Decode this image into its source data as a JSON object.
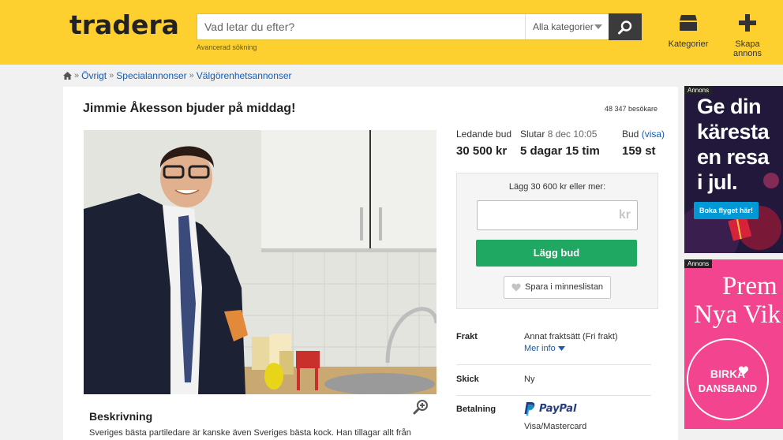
{
  "header": {
    "logo": "tradera",
    "search_placeholder": "Vad letar du efter?",
    "category_select": "Alla kategorier",
    "advanced_search": "Avancerad sökning",
    "categories_label": "Kategorier",
    "create_listing_label": "Skapa annons"
  },
  "breadcrumb": {
    "items": [
      "Övrigt",
      "Specialannonser",
      "Välgörenhetsannonser"
    ],
    "separator": "»"
  },
  "listing": {
    "title": "Jimmie Åkesson bjuder på middag!",
    "visitors": "48 347 besökare",
    "leading_bid_label": "Ledande bud",
    "leading_bid_value": "30 500 kr",
    "ends_label": "Slutar",
    "ends_date": "8 dec 10:05",
    "ends_value": "5 dagar 15 tim",
    "bids_label": "Bud",
    "bids_link": "(visa)",
    "bids_value": "159 st",
    "bid_hint": "Lägg 30 600 kr eller mer:",
    "bid_currency": "kr",
    "bid_button": "Lägg bud",
    "save_button": "Spara i minneslistan",
    "shipping_label": "Frakt",
    "shipping_value": "Annat fraktsätt (Fri frakt)",
    "more_info": "Mer info",
    "condition_label": "Skick",
    "condition_value": "Ny",
    "payment_label": "Betalning",
    "payment_paypal": "PayPal",
    "payment_card": "Visa/Mastercard",
    "description_title": "Beskrivning",
    "description_text": "Sveriges bästa partiledare är kanske även Sveriges bästa kock. Han tillagar allt från"
  },
  "ads": {
    "tag": "Annons",
    "ad1_lines": [
      "Ge din",
      "käresta",
      "en resa",
      "i jul."
    ],
    "ad1_cta": "Boka flyget här!",
    "ad2_lines": [
      "Prem",
      "Nya Vik"
    ],
    "ad2_badge_line1": "BIRKA",
    "ad2_badge_line2": "DANSBAND"
  },
  "colors": {
    "header_bg": "#fed02f",
    "bid_button": "#1ea862",
    "link": "#1a5bb0",
    "ad2_bg": "#f3448f"
  }
}
